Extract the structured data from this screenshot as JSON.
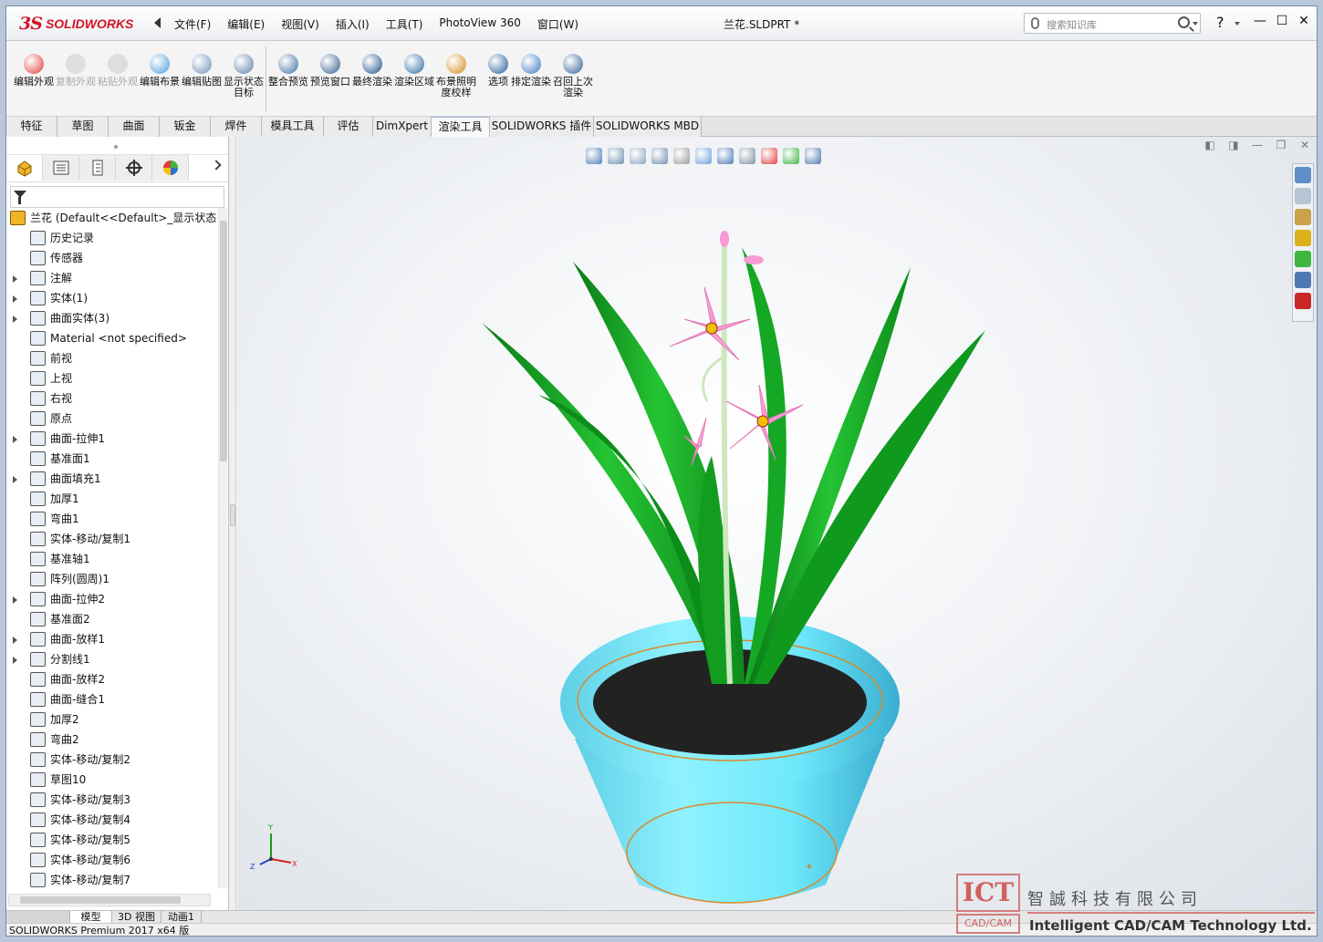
{
  "app": {
    "brand_ds": "3S",
    "brand_name": "SOLIDWORKS",
    "doc_title": "兰花.SLDPRT *"
  },
  "menu": [
    "文件(F)",
    "编辑(E)",
    "视图(V)",
    "插入(I)",
    "工具(T)",
    "PhotoView 360",
    "窗口(W)"
  ],
  "search": {
    "placeholder": "搜索知识库"
  },
  "help_label": "?",
  "window_controls": {
    "minimize": "—",
    "maximize": "☐",
    "close": "✕"
  },
  "ribbon": [
    {
      "label": "编辑外观",
      "icon": "edit-appearance-icon",
      "color": "#e23b3b"
    },
    {
      "label": "复制外观",
      "icon": "copy-appearance-icon",
      "disabled": true
    },
    {
      "label": "粘贴外观",
      "icon": "paste-appearance-icon",
      "disabled": true
    },
    {
      "label": "编辑布景",
      "icon": "edit-scene-icon",
      "color": "#4a9bd8"
    },
    {
      "label": "编辑贴图",
      "icon": "edit-decal-icon",
      "color": "#6b8fb8"
    },
    {
      "label": "显示状态目标",
      "icon": "target-icon",
      "color": "#5b7ea6"
    },
    {
      "label": "整合预览",
      "icon": "integrated-preview-icon",
      "color": "#3b6ea5"
    },
    {
      "label": "预览窗口",
      "icon": "preview-window-icon",
      "color": "#2e5b8a"
    },
    {
      "label": "最终渲染",
      "icon": "final-render-icon",
      "color": "#1d4e89"
    },
    {
      "label": "渲染区域",
      "icon": "render-region-icon",
      "color": "#2c6aa0"
    },
    {
      "label": "布景照明度校样",
      "icon": "lighting-proof-icon",
      "color": "#d38a1c"
    },
    {
      "label": "选项",
      "icon": "options-icon",
      "color": "#1e5a96"
    },
    {
      "label": "排定渲染",
      "icon": "schedule-render-icon",
      "color": "#3a7abf"
    },
    {
      "label": "召回上次渲染",
      "icon": "recall-render-icon",
      "color": "#2e5f96"
    }
  ],
  "cmd_tabs": [
    "特征",
    "草图",
    "曲面",
    "钣金",
    "焊件",
    "模具工具",
    "评估",
    "DimXpert",
    "渲染工具",
    "SOLIDWORKS 插件",
    "SOLIDWORKS MBD"
  ],
  "active_tab": "渲染工具",
  "tree": {
    "root": "兰花  (Default<<Default>_显示状态",
    "items": [
      {
        "label": "历史记录",
        "expandable": false
      },
      {
        "label": "传感器",
        "expandable": false
      },
      {
        "label": "注解",
        "expandable": true
      },
      {
        "label": "实体(1)",
        "expandable": true
      },
      {
        "label": "曲面实体(3)",
        "expandable": true
      },
      {
        "label": "Material <not specified>",
        "expandable": false
      },
      {
        "label": "前视",
        "expandable": false
      },
      {
        "label": "上视",
        "expandable": false
      },
      {
        "label": "右视",
        "expandable": false
      },
      {
        "label": "原点",
        "expandable": false
      },
      {
        "label": "曲面-拉伸1",
        "expandable": true
      },
      {
        "label": "基准面1",
        "expandable": false
      },
      {
        "label": "曲面填充1",
        "expandable": true
      },
      {
        "label": "加厚1",
        "expandable": false
      },
      {
        "label": "弯曲1",
        "expandable": false
      },
      {
        "label": "实体-移动/复制1",
        "expandable": false
      },
      {
        "label": "基准轴1",
        "expandable": false
      },
      {
        "label": "阵列(圆周)1",
        "expandable": false
      },
      {
        "label": "曲面-拉伸2",
        "expandable": true
      },
      {
        "label": "基准面2",
        "expandable": false
      },
      {
        "label": "曲面-放样1",
        "expandable": true
      },
      {
        "label": "分割线1",
        "expandable": true
      },
      {
        "label": "曲面-放样2",
        "expandable": false
      },
      {
        "label": "曲面-缝合1",
        "expandable": false
      },
      {
        "label": "加厚2",
        "expandable": false
      },
      {
        "label": "弯曲2",
        "expandable": false
      },
      {
        "label": "实体-移动/复制2",
        "expandable": false
      },
      {
        "label": "草图10",
        "expandable": false
      },
      {
        "label": "实体-移动/复制3",
        "expandable": false
      },
      {
        "label": "实体-移动/复制4",
        "expandable": false
      },
      {
        "label": "实体-移动/复制5",
        "expandable": false
      },
      {
        "label": "实体-移动/复制6",
        "expandable": false
      },
      {
        "label": "实体-移动/复制7",
        "expandable": false
      }
    ]
  },
  "bottom_tabs": [
    "模型",
    "3D 视图",
    "动画1"
  ],
  "status": "SOLIDWORKS Premium 2017 x64 版",
  "triad": {
    "x": "X",
    "y": "Y",
    "z": "Z"
  },
  "watermark": {
    "logo": "ICT",
    "tag": "CAD/CAM",
    "cn": "智誠科技有限公司",
    "en": "Intelligent CAD/CAM Technology Ltd."
  }
}
